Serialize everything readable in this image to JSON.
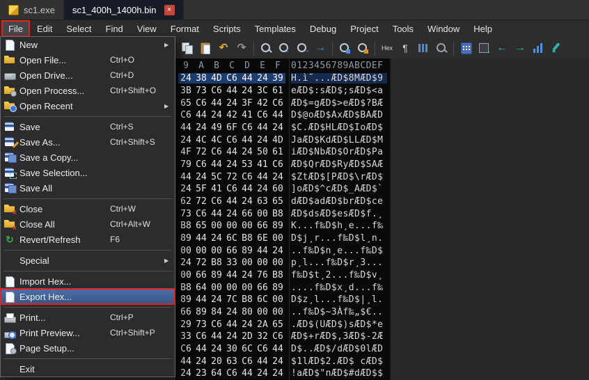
{
  "colors": {
    "annotation_red": "#e8211d",
    "selection_blue": "#1d3c6f",
    "menu_highlight_blue": "#3a5688"
  },
  "tabs": [
    {
      "label": "sc1.exe"
    },
    {
      "label": "sc1_400h_1400h.bin",
      "close_glyph": "×",
      "active": true
    }
  ],
  "menubar": {
    "open_index": 0,
    "items": [
      "File",
      "Edit",
      "Select",
      "Find",
      "View",
      "Format",
      "Scripts",
      "Templates",
      "Debug",
      "Project",
      "Tools",
      "Window",
      "Help"
    ]
  },
  "file_menu": {
    "submenu_arrow": "▶",
    "items": [
      {
        "name": "menu-item-new",
        "label": "New",
        "icon": "mi-new",
        "submenu": true
      },
      {
        "name": "menu-item-open-file",
        "label": "Open File...",
        "shortcut": "Ctrl+O",
        "icon": "mi-open"
      },
      {
        "name": "menu-item-open-drive",
        "label": "Open Drive...",
        "shortcut": "Ctrl+D",
        "icon": "mi-drive"
      },
      {
        "name": "menu-item-open-process",
        "label": "Open Process...",
        "shortcut": "Ctrl+Shift+O",
        "icon": "mi-process"
      },
      {
        "name": "menu-item-open-recent",
        "label": "Open Recent",
        "icon": "mi-recent",
        "submenu": true
      },
      {
        "type": "separator"
      },
      {
        "name": "menu-item-save",
        "label": "Save",
        "shortcut": "Ctrl+S",
        "icon": "mi-save"
      },
      {
        "name": "menu-item-save-as",
        "label": "Save As...",
        "shortcut": "Ctrl+Shift+S",
        "icon": "mi-save-as"
      },
      {
        "name": "menu-item-save-a-copy",
        "label": "Save a Copy...",
        "icon": "mi-save-copy"
      },
      {
        "name": "menu-item-save-selection",
        "label": "Save Selection...",
        "icon": "mi-save-sel"
      },
      {
        "name": "menu-item-save-all",
        "label": "Save All",
        "icon": "mi-save-all"
      },
      {
        "type": "separator"
      },
      {
        "name": "menu-item-close",
        "label": "Close",
        "shortcut": "Ctrl+W",
        "icon": "mi-close"
      },
      {
        "name": "menu-item-close-all",
        "label": "Close All",
        "shortcut": "Ctrl+Alt+W",
        "icon": "mi-close-all"
      },
      {
        "name": "menu-item-revert-refresh",
        "label": "Revert/Refresh",
        "shortcut": "F6",
        "icon": "mi-revert"
      },
      {
        "type": "separator"
      },
      {
        "name": "menu-item-special",
        "label": "Special",
        "submenu": true
      },
      {
        "type": "separator"
      },
      {
        "name": "menu-item-import-hex",
        "label": "Import Hex...",
        "icon": "mi-import"
      },
      {
        "name": "menu-item-export-hex",
        "label": "Export Hex...",
        "icon": "mi-export",
        "selected": true,
        "annotated": true
      },
      {
        "type": "separator"
      },
      {
        "name": "menu-item-print",
        "label": "Print...",
        "shortcut": "Ctrl+P",
        "icon": "mi-print"
      },
      {
        "name": "menu-item-print-preview",
        "label": "Print Preview...",
        "shortcut": "Ctrl+Shift+P",
        "icon": "mi-preview"
      },
      {
        "name": "menu-item-page-setup",
        "label": "Page Setup...",
        "icon": "mi-pagesetup"
      },
      {
        "type": "separator"
      },
      {
        "name": "menu-item-exit",
        "label": "Exit"
      }
    ]
  },
  "toolbar": {
    "buttons": [
      {
        "name": "copy-icon",
        "cls": "tc-copy"
      },
      {
        "name": "paste-icon",
        "cls": "tc-paste"
      },
      {
        "name": "undo-icon",
        "cls": "tc-undo"
      },
      {
        "name": "redo-icon",
        "cls": "tc-redo"
      },
      {
        "separator": true
      },
      {
        "name": "find-icon",
        "cls": "tc-find"
      },
      {
        "name": "find-next-icon",
        "cls": "tc-find tc-down"
      },
      {
        "name": "find-in-files-icon",
        "cls": "tc-find tc-right"
      },
      {
        "name": "goto-icon",
        "cls": "tc-goto"
      },
      {
        "separator": true
      },
      {
        "name": "find-strings-icon",
        "cls": "tc-find tc-blue"
      },
      {
        "name": "replace-icon",
        "cls": "tc-find tc-orange"
      },
      {
        "separator": true
      },
      {
        "name": "hex-display-icon",
        "cls": "tc-hex",
        "label": "Hex"
      },
      {
        "name": "show-whitespace-icon",
        "cls": "tc-pilcrow"
      },
      {
        "name": "column-mode-icon",
        "cls": "tc-columns"
      },
      {
        "name": "inspector-icon",
        "cls": "tc-find tc-gray"
      },
      {
        "separator": true
      },
      {
        "name": "calculator-icon",
        "cls": "tc-calc"
      },
      {
        "name": "goto-address-icon",
        "cls": "tc-grid-go"
      },
      {
        "name": "navigate-back-icon",
        "cls": "tc-nav-left"
      },
      {
        "name": "navigate-forward-icon",
        "cls": "tc-nav-right"
      },
      {
        "name": "histogram-icon",
        "cls": "tc-histogram"
      },
      {
        "name": "edit-mode-icon",
        "cls": "tc-pencil"
      }
    ]
  },
  "hex_editor": {
    "column_headers": [
      "9",
      "A",
      "B",
      "C",
      "D",
      "E",
      "F"
    ],
    "ascii_header": "0123456789ABCDEF",
    "rows": [
      {
        "hex": [
          "24",
          "38",
          "4D",
          "C6",
          "44",
          "24",
          "39"
        ],
        "ascii": "H.ì˜...ÆD$8MÆD$9",
        "selected": true
      },
      {
        "hex": [
          "3B",
          "73",
          "C6",
          "44",
          "24",
          "3C",
          "61"
        ],
        "ascii": "eÆD$:sÆD$;sÆD$<a"
      },
      {
        "hex": [
          "65",
          "C6",
          "44",
          "24",
          "3F",
          "42",
          "C6"
        ],
        "ascii": "ÆD$=gÆD$>eÆD$?BÆ"
      },
      {
        "hex": [
          "C6",
          "44",
          "24",
          "42",
          "41",
          "C6",
          "44"
        ],
        "ascii": "D$@oÆD$AxÆD$BAÆD"
      },
      {
        "hex": [
          "44",
          "24",
          "49",
          "6F",
          "C6",
          "44",
          "24"
        ],
        "ascii": "$C.ÆD$HLÆD$IoÆD$"
      },
      {
        "hex": [
          "24",
          "4C",
          "4C",
          "C6",
          "44",
          "24",
          "4D"
        ],
        "ascii": "JaÆD$KdÆD$LLÆD$M"
      },
      {
        "hex": [
          "4F",
          "72",
          "C6",
          "44",
          "24",
          "50",
          "61"
        ],
        "ascii": "iÆD$NbÆD$OrÆD$Pa"
      },
      {
        "hex": [
          "79",
          "C6",
          "44",
          "24",
          "53",
          "41",
          "C6"
        ],
        "ascii": "ÆD$QrÆD$RyÆD$SAÆ"
      },
      {
        "hex": [
          "44",
          "24",
          "5C",
          "72",
          "C6",
          "44",
          "24"
        ],
        "ascii": "$ZtÆD$[PÆD$\\rÆD$"
      },
      {
        "hex": [
          "24",
          "5F",
          "41",
          "C6",
          "44",
          "24",
          "60"
        ],
        "ascii": "]oÆD$^cÆD$_AÆD$`"
      },
      {
        "hex": [
          "62",
          "72",
          "C6",
          "44",
          "24",
          "63",
          "65"
        ],
        "ascii": "dÆD$adÆD$brÆD$ce"
      },
      {
        "hex": [
          "73",
          "C6",
          "44",
          "24",
          "66",
          "00",
          "B8"
        ],
        "ascii": "ÆD$dsÆD$esÆD$f.¸"
      },
      {
        "hex": [
          "B8",
          "65",
          "00",
          "00",
          "00",
          "66",
          "89"
        ],
        "ascii": "K...f‰D$h¸e...f‰"
      },
      {
        "hex": [
          "89",
          "44",
          "24",
          "6C",
          "B8",
          "6E",
          "00"
        ],
        "ascii": "D$j¸r...f‰D$l¸n."
      },
      {
        "hex": [
          "00",
          "00",
          "00",
          "66",
          "89",
          "44",
          "24"
        ],
        "ascii": "..f‰D$n¸e...f‰D$"
      },
      {
        "hex": [
          "24",
          "72",
          "B8",
          "33",
          "00",
          "00",
          "00"
        ],
        "ascii": "p¸l...f‰D$r¸3..."
      },
      {
        "hex": [
          "00",
          "66",
          "89",
          "44",
          "24",
          "76",
          "B8"
        ],
        "ascii": "f‰D$t¸2...f‰D$v¸"
      },
      {
        "hex": [
          "B8",
          "64",
          "00",
          "00",
          "00",
          "66",
          "89"
        ],
        "ascii": "....f‰D$x¸d...f‰"
      },
      {
        "hex": [
          "89",
          "44",
          "24",
          "7C",
          "B8",
          "6C",
          "00"
        ],
        "ascii": "D$z¸l...f‰D$|¸l."
      },
      {
        "hex": [
          "66",
          "89",
          "84",
          "24",
          "80",
          "00",
          "00"
        ],
        "ascii": "..f‰D$~3Àf‰„$€.."
      },
      {
        "hex": [
          "29",
          "73",
          "C6",
          "44",
          "24",
          "2A",
          "65"
        ],
        "ascii": ".ÆD$(UÆD$)sÆD$*e"
      },
      {
        "hex": [
          "33",
          "C6",
          "44",
          "24",
          "2D",
          "32",
          "C6"
        ],
        "ascii": "ÆD$+rÆD$,3ÆD$-2Æ"
      },
      {
        "hex": [
          "C6",
          "44",
          "24",
          "30",
          "6C",
          "C6",
          "44"
        ],
        "ascii": "D$..ÆD$/dÆD$0lÆD"
      },
      {
        "hex": [
          "44",
          "24",
          "20",
          "63",
          "C6",
          "44",
          "24"
        ],
        "ascii": "$1lÆD$2.ÆD$ cÆD$"
      },
      {
        "hex": [
          "24",
          "23",
          "64",
          "C6",
          "44",
          "24",
          "24"
        ],
        "ascii": "!aÆD$\"nÆD$#dÆD$$"
      }
    ]
  }
}
